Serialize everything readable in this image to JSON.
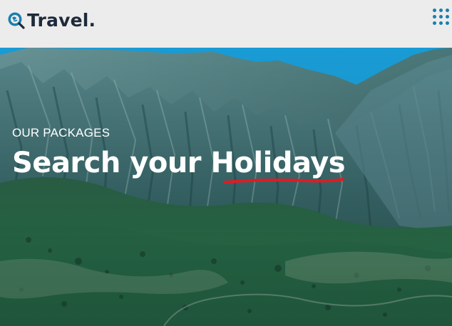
{
  "header": {
    "logo_text": "Travel."
  },
  "hero": {
    "eyebrow": "OUR PACKAGES",
    "headline_prefix": "Search your ",
    "headline_highlight": "Holidays"
  },
  "icons": {
    "logo": "globe-search-icon",
    "menu": "grid-menu-icon"
  },
  "colors": {
    "header_bg": "#ececec",
    "logo_text": "#1d2a3a",
    "accent_blue": "#1a7fae",
    "underline_red": "#e01b24",
    "sky": "#1aa3e0"
  }
}
